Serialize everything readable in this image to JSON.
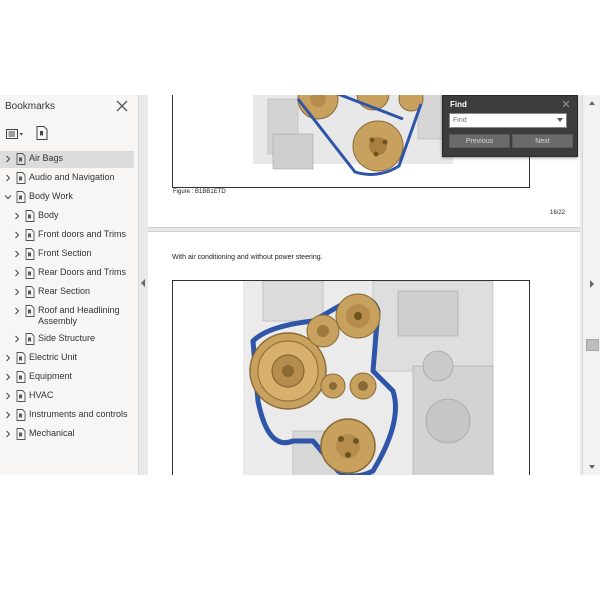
{
  "sidebar": {
    "title": "Bookmarks",
    "items": [
      {
        "label": "Air Bags",
        "expanded": false
      },
      {
        "label": "Audio and Navigation",
        "expanded": false
      },
      {
        "label": "Body Work",
        "expanded": true
      },
      {
        "label": "Body",
        "expanded": false
      },
      {
        "label": "Front doors and Trims",
        "expanded": false
      },
      {
        "label": "Front Section",
        "expanded": false
      },
      {
        "label": "Rear Doors and Trims",
        "expanded": false
      },
      {
        "label": "Rear Section",
        "expanded": false
      },
      {
        "label": "Roof and Headlining Assembly",
        "expanded": false
      },
      {
        "label": "Side Structure",
        "expanded": false
      },
      {
        "label": "Electric Unit",
        "expanded": false
      },
      {
        "label": "Equipment",
        "expanded": false
      },
      {
        "label": "HVAC",
        "expanded": false
      },
      {
        "label": "Instruments and controls",
        "expanded": false
      },
      {
        "label": "Mechanical",
        "expanded": false
      }
    ]
  },
  "document": {
    "page1": {
      "caption": "Figure : B1BB1ETD",
      "page_number": "16/22"
    },
    "page2": {
      "description": "With air conditioning and without power steering."
    }
  },
  "find": {
    "title": "Find",
    "placeholder": "Find",
    "previous_label": "Previous",
    "next_label": "Next"
  },
  "colors": {
    "belt": "#2f55a8",
    "pulley": "#c9a15f",
    "selected_row": "#dcdcdc",
    "find_panel": "#3c3c3c"
  }
}
